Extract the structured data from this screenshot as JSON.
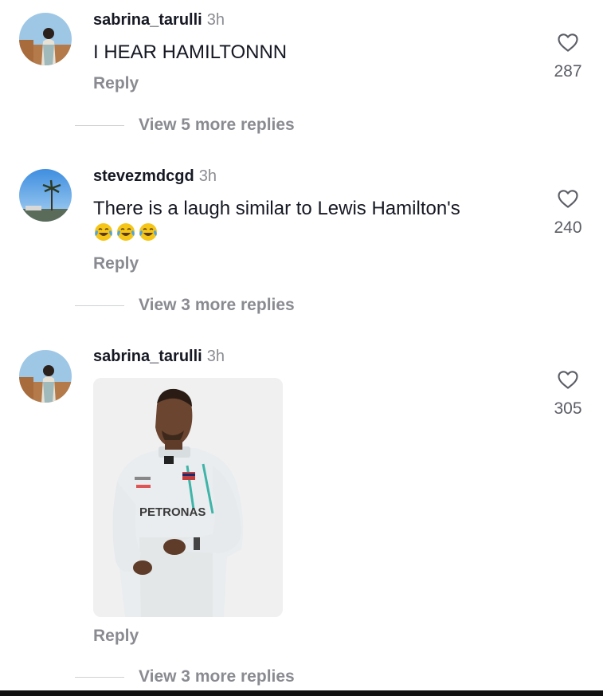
{
  "comments": [
    {
      "username": "sabrina_tarulli",
      "time": "3h",
      "text": "I HEAR HAMILTONNN",
      "reply_label": "Reply",
      "like_count": "287",
      "view_more": "View 5 more replies",
      "avatar_icon": "user-avatar-photo"
    },
    {
      "username": "stevezmdcgd",
      "time": "3h",
      "text": "There is a laugh similar to Lewis Hamilton's",
      "emojis": [
        "face-with-tears-of-joy",
        "face-with-tears-of-joy",
        "face-with-tears-of-joy"
      ],
      "reply_label": "Reply",
      "like_count": "240",
      "view_more": "View 3 more replies",
      "avatar_icon": "palm-tree-avatar"
    },
    {
      "username": "sabrina_tarulli",
      "time": "3h",
      "gif": {
        "description_icon": "racing-driver-gif",
        "suit_text": "PETRONAS"
      },
      "reply_label": "Reply",
      "like_count": "305",
      "view_more": "View 3 more replies",
      "avatar_icon": "user-avatar-photo"
    }
  ],
  "icons": {
    "like": "heart-outline-icon"
  },
  "colors": {
    "text": "#161823",
    "secondary": "#8a8b91",
    "count": "#5c5e66"
  }
}
